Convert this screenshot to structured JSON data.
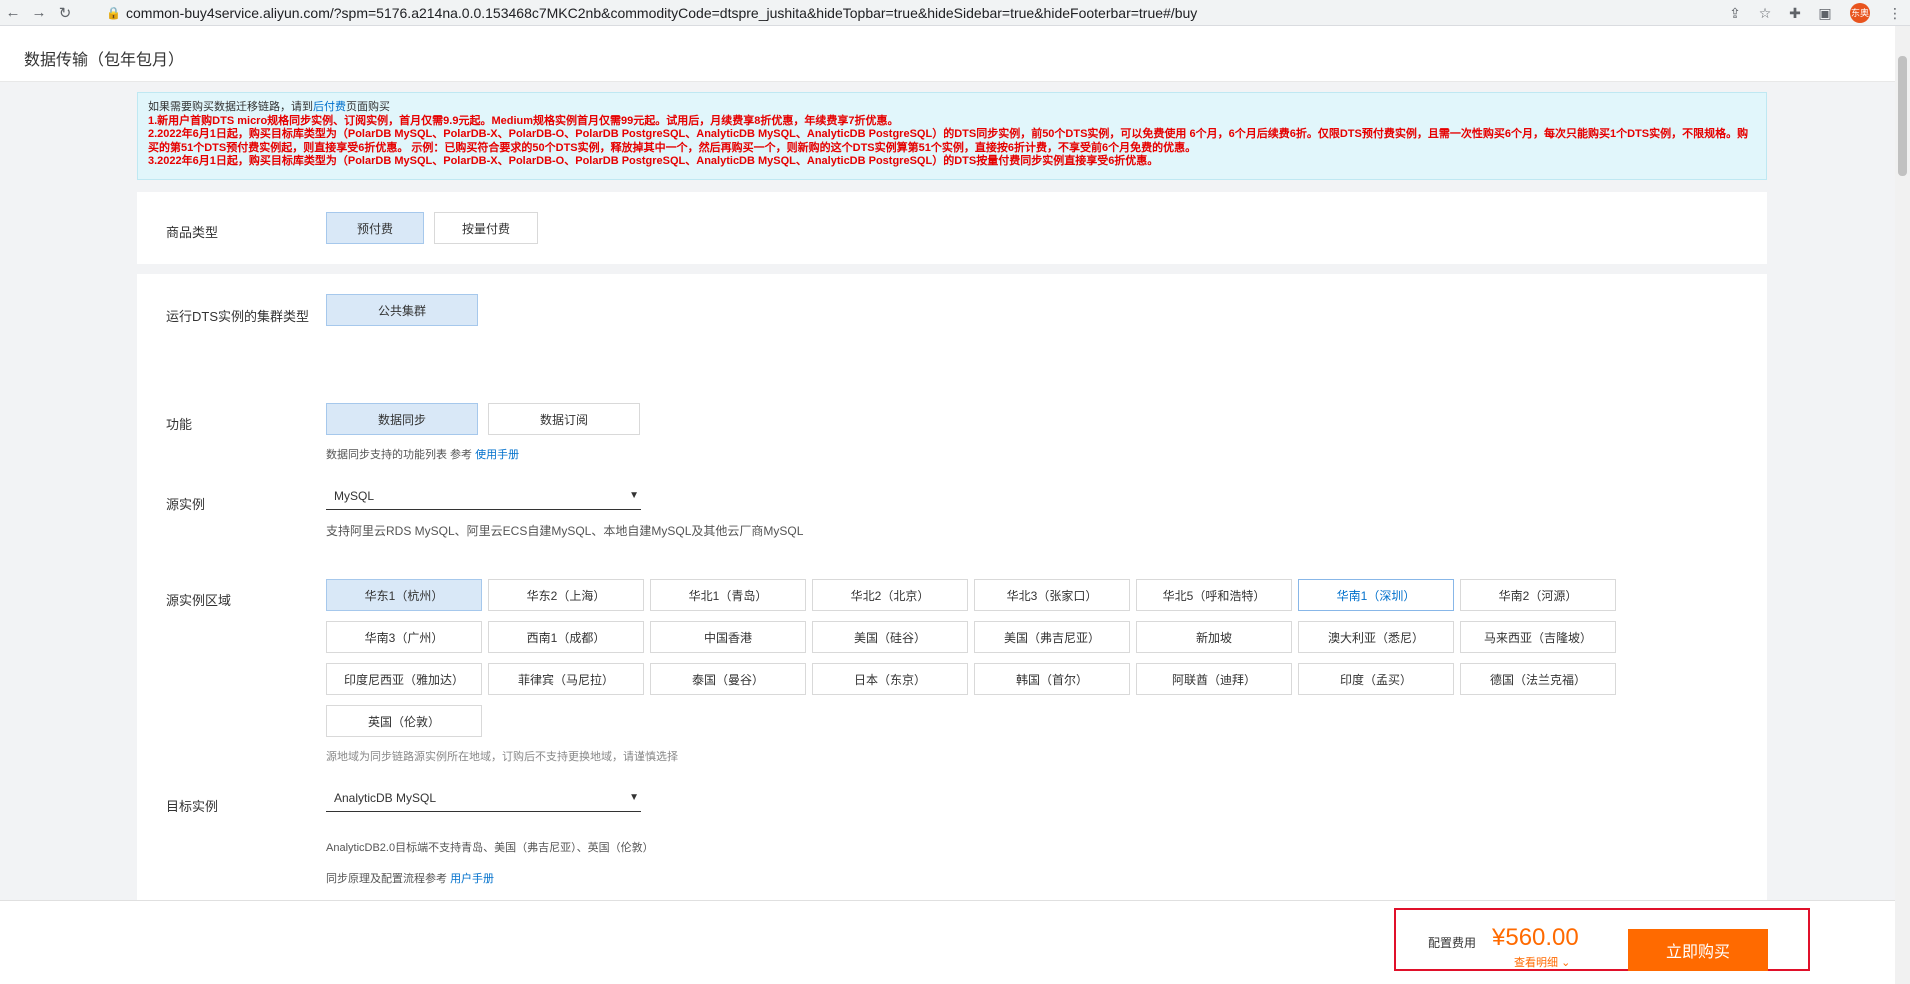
{
  "browser": {
    "url": "common-buy4service.aliyun.com/?spm=5176.a214na.0.0.153468c7MKC2nb&commodityCode=dtspre_jushita&hideTopbar=true&hideSidebar=true&hideFooterbar=true#/buy",
    "avatar_text": "东奥"
  },
  "page": {
    "title": "数据传输（包年包月）"
  },
  "notice": {
    "line0_prefix": "如果需要购买数据迁移链路，请到",
    "line0_link": "后付费",
    "line0_suffix": "页面购买",
    "line1": "1.新用户首购DTS micro规格同步实例、订阅实例，首月仅需9.9元起。Medium规格实例首月仅需99元起。试用后，月续费享8折优惠，年续费享7折优惠。",
    "line2": "2.2022年6月1日起，购买目标库类型为（PolarDB MySQL、PolarDB-X、PolarDB-O、PolarDB PostgreSQL、AnalyticDB MySQL、AnalyticDB PostgreSQL）的DTS同步实例，前50个DTS实例，可以免费使用 6个月，6个月后续费6折。仅限DTS预付费实例，且需一次性购买6个月，每次只能购买1个DTS实例，不限规格。购买的第51个DTS预付费实例起，则直接享受6折优惠。 示例：已购买符合要求的50个DTS实例，释放掉其中一个，然后再购买一个，则新购的这个DTS实例算第51个实例，直接按6折计费，不享受前6个月免费的优惠。",
    "line3": "3.2022年6月1日起，购买目标库类型为（PolarDB MySQL、PolarDB-X、PolarDB-O、PolarDB PostgreSQL、AnalyticDB MySQL、AnalyticDB PostgreSQL）的DTS按量付费同步实例直接享受6折优惠。"
  },
  "product_type": {
    "label": "商品类型",
    "options": [
      "预付费",
      "按量付费"
    ],
    "selected": "预付费"
  },
  "cluster": {
    "label": "运行DTS实例的集群类型",
    "options": [
      "公共集群"
    ],
    "selected": "公共集群"
  },
  "function": {
    "label": "功能",
    "options": [
      "数据同步",
      "数据订阅"
    ],
    "selected": "数据同步",
    "hint_prefix": "数据同步支持的功能列表 参考",
    "hint_link": "使用手册"
  },
  "source": {
    "label": "源实例",
    "value": "MySQL",
    "hint": "支持阿里云RDS MySQL、阿里云ECS自建MySQL、本地自建MySQL及其他云厂商MySQL"
  },
  "region": {
    "label": "源实例区域",
    "options": [
      "华东1（杭州）",
      "华东2（上海）",
      "华北1（青岛）",
      "华北2（北京）",
      "华北3（张家口）",
      "华北5（呼和浩特）",
      "华南1（深圳）",
      "华南2（河源）",
      "华南3（广州）",
      "西南1（成都）",
      "中国香港",
      "美国（硅谷）",
      "美国（弗吉尼亚）",
      "新加坡",
      "澳大利亚（悉尼）",
      "马来西亚（吉隆坡）",
      "印度尼西亚（雅加达）",
      "菲律宾（马尼拉）",
      "泰国（曼谷）",
      "日本（东京）",
      "韩国（首尔）",
      "阿联酋（迪拜）",
      "印度（孟买）",
      "德国（法兰克福）",
      "英国（伦敦）"
    ],
    "selected": "华东1（杭州）",
    "hovered": "华南1（深圳）",
    "hint": "源地域为同步链路源实例所在地域，订购后不支持更换地域，请谨慎选择"
  },
  "target": {
    "label": "目标实例",
    "value": "AnalyticDB MySQL",
    "hint1": "AnalyticDB2.0目标端不支持青岛、美国（弗吉尼亚）、英国（伦敦）",
    "hint2_prefix": "同步原理及配置流程参考",
    "hint2_link": "用户手册"
  },
  "footer": {
    "price_label": "配置费用",
    "price": "¥560.00",
    "detail": "查看明细",
    "buy": "立即购买"
  },
  "colors": {
    "accent": "#ff6a00",
    "selected_bg": "#d9e8f7",
    "notice_red": "#e60000"
  }
}
